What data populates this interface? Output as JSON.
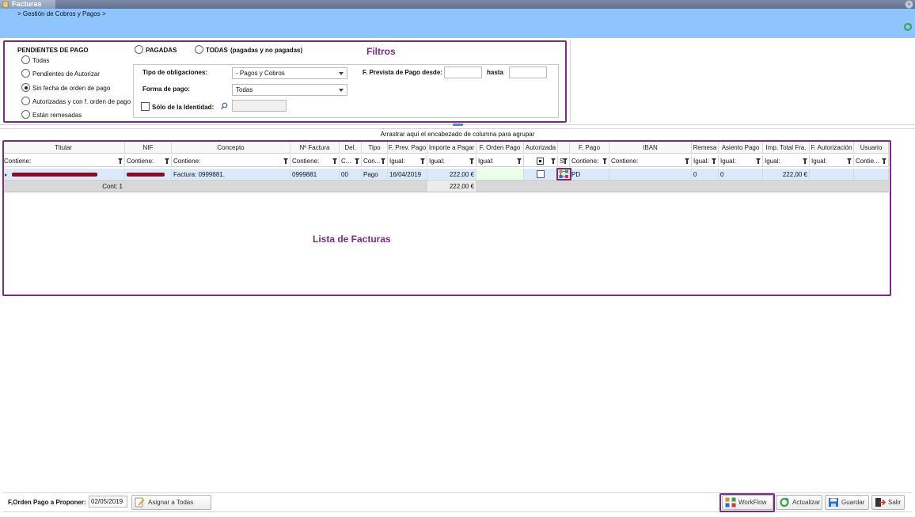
{
  "window": {
    "tab_title": "Facturas"
  },
  "header": {
    "breadcrumb": "> Gestión de Cobros y Pagos   >"
  },
  "filters": {
    "annotation": "Filtros",
    "pendientes_title": "PENDIENTES DE PAGO",
    "pagadas": "PAGADAS",
    "todas": "TODAS",
    "todas_suffix": "(pagadas y no pagadas)",
    "options": [
      "Todas",
      "Pendientes de Autorizar",
      "Sin fecha de orden de pago",
      "Autorizadas y con f. orden de pago",
      "Están remesadas"
    ],
    "selected_option": "Sin fecha de orden de pago",
    "tipo_obligaciones_label": "Tipo de obligaciones:",
    "tipo_obligaciones_value": "- Pagos y Cobros",
    "forma_pago_label": "Forma de pago:",
    "forma_pago_value": "Todas",
    "solo_identidad_label": "Sólo de la Identidad:",
    "f_prevista_desde_label": "F. Prevista de Pago desde:",
    "hasta_label": "hasta"
  },
  "grid": {
    "group_hint": "Arrastrar aquí el encabezado de columna para agrupar",
    "annotation": "Lista de Facturas",
    "columns": [
      "Titular",
      "NIF",
      "Concepto",
      "Nº Factura",
      "Del.",
      "Tipo",
      "F. Prev. Pago",
      "Importe a Pagar",
      "F. Orden Pago",
      "Autorizada",
      "",
      "F. Pago",
      "IBAN",
      "Remesa",
      "Asiento Pago",
      "Imp. Total Fra.",
      "F. Autorización",
      "Usuario"
    ],
    "filters": [
      "Contiene:",
      "Contiene:",
      "Contiene:",
      "Contiene:",
      "C...",
      "Con...",
      "Igual:",
      "Igual:",
      "Igual:",
      "",
      "S",
      "Contiene:",
      "Contiene:",
      "Igual:",
      "Igual:",
      "Igual:",
      "Igual:",
      "Contie..."
    ],
    "row": {
      "concepto": "Factura: 0999881.",
      "n_factura": "0999881",
      "del": "00",
      "tipo": "Pago",
      "f_prev_pago": "16/04/2019",
      "importe": "222,00 €",
      "f_pago": "PD",
      "remesa": "0",
      "asiento": "0",
      "imp_total": "222,00 €"
    },
    "footer": {
      "count": "Cont: 1",
      "importe_total": "222,00 €"
    }
  },
  "bottom": {
    "f_orden_label": "F,Orden Pago a Proponer:",
    "f_orden_value": "02/05/2019",
    "asignar": "Asignar a Todas",
    "workflow": "WorkFlow",
    "actualizar": "Actualizar",
    "guardar": "Guardar",
    "salir": "Salir"
  },
  "colors": {
    "accent_frame": "#7b2b84",
    "header_bg": "#8fc5ff",
    "selected_row": "#dbeafb"
  }
}
